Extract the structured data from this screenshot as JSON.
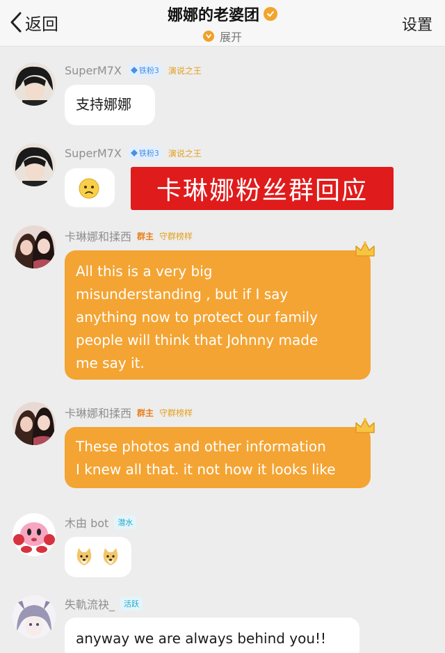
{
  "header": {
    "back_label": "返回",
    "title": "娜娜的老婆团",
    "expand_label": "展开",
    "settings_label": "设置"
  },
  "messages": [
    {
      "sender": "SuperM7X",
      "badges": [
        "铁粉3",
        "演说之王"
      ],
      "text": "支持娜娜"
    },
    {
      "sender": "SuperM7X",
      "badges": [
        "铁粉3",
        "演说之王"
      ],
      "text": "",
      "emoji": "worried-face"
    },
    {
      "sender": "卡琳娜和揉西",
      "badges": [
        "群主",
        "守群榜样"
      ],
      "lines": [
        "All this is a very big",
        "misunderstanding , but if I say",
        "anything now to protect our family",
        "people will think that Johnny made",
        "me say it."
      ]
    },
    {
      "sender": "卡琳娜和揉西",
      "badges": [
        "群主",
        "守群榜样"
      ],
      "lines": [
        "These photos and other information",
        "I knew all that. it not how it looks like"
      ]
    },
    {
      "sender": "木由 bot",
      "badges": [
        "潜水"
      ],
      "emoji": "doge-stickers"
    },
    {
      "sender": "失軌流袂_",
      "badges": [
        "活跃"
      ],
      "text": "anyway we are always behind you!!"
    }
  ],
  "banner_text": "卡琳娜粉丝群回应",
  "colors": {
    "orange_bubble": "#f4a433",
    "banner_red": "#e01b1b",
    "background": "#ededed"
  }
}
